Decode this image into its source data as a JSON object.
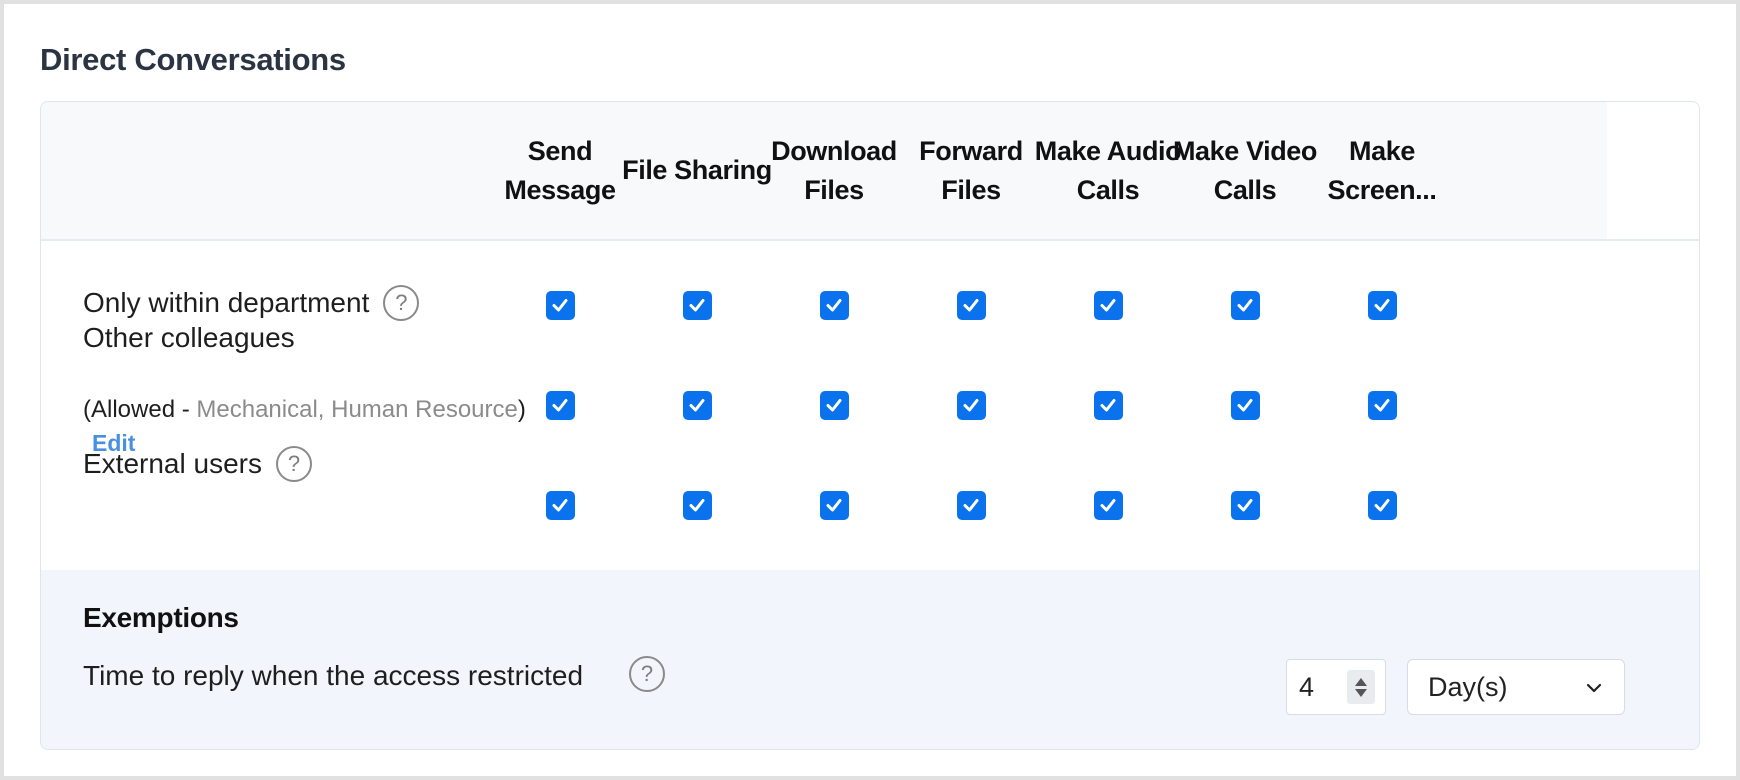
{
  "section_title": "Direct Conversations",
  "columns": [
    "Send\nMessage",
    "File Sharing",
    "Download\nFiles",
    "Forward\nFiles",
    "Make Audio\nCalls",
    "Make Video\nCalls",
    "Make\nScreen..."
  ],
  "rows": [
    {
      "label": "Only within department",
      "has_help": true,
      "checked": [
        true,
        true,
        true,
        true,
        true,
        true,
        true
      ]
    },
    {
      "label": "Other colleagues",
      "has_help": false,
      "checked": [
        true,
        true,
        true,
        true,
        true,
        true,
        true
      ]
    },
    {
      "label": "External users",
      "has_help": true,
      "checked": [
        true,
        true,
        true,
        true,
        true,
        true,
        true
      ]
    }
  ],
  "other_colleagues": {
    "allowed_prefix": "(Allowed - ",
    "allowed_departments": "Mechanical, Human Resource",
    "allowed_suffix": ")",
    "edit_label": "Edit"
  },
  "help_glyph": "?",
  "exemptions": {
    "title": "Exemptions",
    "label": "Time to reply when the access restricted",
    "value": "4",
    "unit": "Day(s)"
  },
  "colors": {
    "checkbox": "#0b72ee",
    "link": "#4a90e2",
    "exemptions_bg": "#f2f6fc",
    "header_bg": "#f7f9fb"
  }
}
